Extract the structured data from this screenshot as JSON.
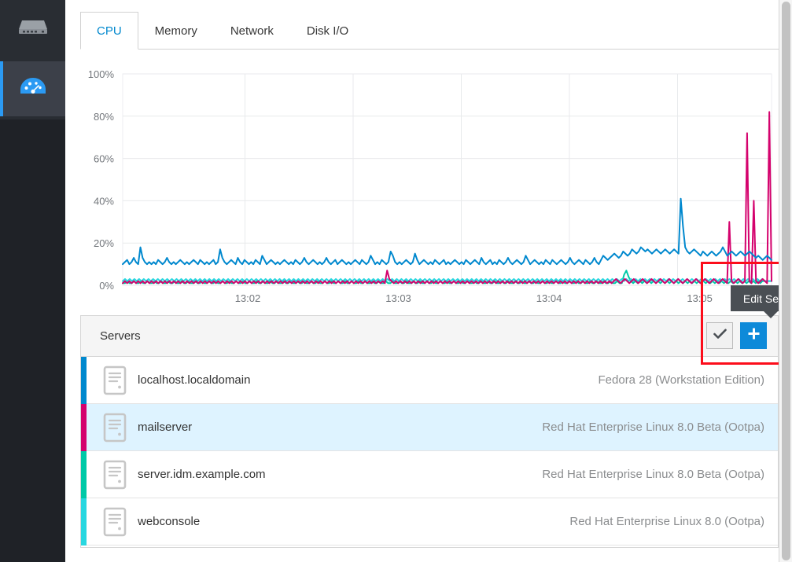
{
  "sidebar": {
    "items": [
      {
        "name": "servers-nav",
        "icon": "server-rack-icon",
        "active": false
      },
      {
        "name": "dashboard-nav",
        "icon": "gauge-dashboard-icon",
        "active": true
      }
    ],
    "accent": "#2b9af3",
    "bg": "#292d33",
    "active_bg": "#3c4049"
  },
  "tabs": [
    {
      "label": "CPU",
      "active": true
    },
    {
      "label": "Memory",
      "active": false
    },
    {
      "label": "Network",
      "active": false
    },
    {
      "label": "Disk I/O",
      "active": false
    }
  ],
  "panel": {
    "title": "Servers",
    "check_button_label": "✔",
    "add_button_label": "+",
    "check_button_name": "edit-server-toggle",
    "add_button_name": "add-server-button"
  },
  "tooltip": {
    "text": "Edit Server"
  },
  "annotation": {
    "color": "#fc0d1b"
  },
  "servers": [
    {
      "name": "localhost.localdomain",
      "os": "Fedora 28 (Workstation Edition)",
      "color": "#0088ce",
      "selected": false
    },
    {
      "name": "mailserver",
      "os": "Red Hat Enterprise Linux 8.0 Beta (Ootpa)",
      "color": "#d4026d",
      "selected": true
    },
    {
      "name": "server.idm.example.com",
      "os": "Red Hat Enterprise Linux 8.0 Beta (Ootpa)",
      "color": "#00c9a7",
      "selected": false
    },
    {
      "name": "webconsole",
      "os": "Red Hat Enterprise Linux 8.0 (Ootpa)",
      "color": "#28d7e0",
      "selected": false
    }
  ],
  "chart_data": {
    "type": "line",
    "title": "",
    "xlabel": "",
    "ylabel": "",
    "ylim": [
      0,
      100
    ],
    "ytick_labels": [
      "0%",
      "20%",
      "40%",
      "60%",
      "80%",
      "100%"
    ],
    "yticks": [
      0,
      20,
      40,
      60,
      80,
      100
    ],
    "xtick_labels": [
      "13:02",
      "13:03",
      "13:04",
      "13:05"
    ],
    "xticks": [
      0.205,
      0.452,
      0.699,
      0.946
    ],
    "grid": true,
    "legend": "none",
    "series": [
      {
        "name": "localhost.localdomain",
        "color": "#0088ce",
        "values": [
          10,
          11,
          12,
          10,
          11,
          13,
          11,
          10,
          18,
          13,
          11,
          10,
          11,
          10,
          11,
          10,
          12,
          11,
          10,
          11,
          13,
          11,
          10,
          11,
          10,
          11,
          12,
          11,
          10,
          11,
          10,
          11,
          12,
          11,
          10,
          12,
          11,
          10,
          11,
          10,
          11,
          12,
          10,
          11,
          17,
          13,
          11,
          10,
          11,
          12,
          11,
          10,
          13,
          11,
          10,
          12,
          11,
          10,
          11,
          10,
          12,
          11,
          10,
          14,
          12,
          10,
          11,
          12,
          11,
          10,
          11,
          10,
          11,
          12,
          11,
          10,
          11,
          10,
          12,
          11,
          10,
          11,
          13,
          11,
          10,
          11,
          12,
          11,
          10,
          11,
          10,
          11,
          13,
          11,
          10,
          11,
          12,
          10,
          11,
          12,
          11,
          10,
          11,
          10,
          11,
          12,
          11,
          10,
          12,
          11,
          10,
          11,
          14,
          12,
          10,
          11,
          10,
          12,
          11,
          10,
          11,
          16,
          14,
          11,
          10,
          11,
          10,
          11,
          12,
          11,
          10,
          11,
          15,
          12,
          10,
          11,
          12,
          11,
          10,
          11,
          10,
          12,
          11,
          10,
          11,
          12,
          10,
          11,
          10,
          11,
          12,
          11,
          10,
          11,
          10,
          12,
          11,
          10,
          11,
          12,
          11,
          10,
          13,
          11,
          10,
          11,
          12,
          10,
          11,
          10,
          12,
          11,
          10,
          11,
          13,
          11,
          10,
          11,
          12,
          11,
          10,
          11,
          14,
          12,
          10,
          11,
          12,
          11,
          10,
          11,
          10,
          12,
          11,
          10,
          12,
          11,
          10,
          11,
          12,
          11,
          10,
          11,
          13,
          11,
          10,
          11,
          12,
          11,
          10,
          12,
          11,
          10,
          11,
          13,
          11,
          10,
          12,
          14,
          13,
          12,
          13,
          14,
          15,
          14,
          13,
          14,
          16,
          15,
          14,
          15,
          17,
          16,
          15,
          16,
          18,
          17,
          16,
          17,
          16,
          15,
          16,
          17,
          16,
          15,
          16,
          17,
          16,
          15,
          16,
          17,
          16,
          15,
          41,
          28,
          18,
          16,
          15,
          16,
          17,
          16,
          15,
          14,
          16,
          15,
          14,
          15,
          16,
          15,
          14,
          15,
          16,
          18,
          16,
          14,
          15,
          16,
          15,
          14,
          15,
          16,
          15,
          14,
          15,
          16,
          15,
          14,
          13,
          14,
          13,
          12,
          13,
          14,
          13,
          12
        ]
      },
      {
        "name": "mailserver",
        "color": "#d4026d",
        "values": [
          1,
          2,
          1,
          2,
          1,
          2,
          1,
          2,
          1,
          2,
          1,
          2,
          1,
          2,
          1,
          2,
          1,
          2,
          1,
          2,
          1,
          2,
          1,
          2,
          1,
          2,
          1,
          2,
          1,
          2,
          1,
          2,
          1,
          2,
          1,
          2,
          1,
          2,
          1,
          2,
          1,
          2,
          1,
          2,
          1,
          2,
          1,
          2,
          1,
          2,
          1,
          2,
          1,
          2,
          1,
          2,
          1,
          2,
          1,
          2,
          1,
          2,
          1,
          2,
          1,
          2,
          1,
          2,
          1,
          2,
          1,
          2,
          1,
          2,
          1,
          2,
          1,
          2,
          1,
          2,
          1,
          2,
          1,
          2,
          1,
          2,
          1,
          2,
          1,
          2,
          1,
          2,
          1,
          2,
          1,
          2,
          1,
          2,
          1,
          2,
          1,
          2,
          1,
          2,
          1,
          2,
          1,
          2,
          1,
          2,
          1,
          2,
          1,
          2,
          1,
          2,
          1,
          2,
          1,
          7,
          3,
          2,
          1,
          2,
          1,
          2,
          1,
          2,
          1,
          2,
          1,
          2,
          1,
          2,
          1,
          2,
          1,
          2,
          1,
          2,
          1,
          2,
          1,
          2,
          1,
          2,
          1,
          2,
          1,
          2,
          1,
          2,
          1,
          2,
          1,
          2,
          1,
          2,
          1,
          2,
          1,
          2,
          1,
          2,
          1,
          2,
          1,
          2,
          1,
          2,
          1,
          2,
          1,
          2,
          1,
          2,
          1,
          2,
          1,
          2,
          1,
          2,
          1,
          2,
          1,
          2,
          1,
          2,
          1,
          2,
          1,
          2,
          1,
          2,
          1,
          2,
          1,
          2,
          1,
          2,
          1,
          2,
          1,
          2,
          1,
          2,
          1,
          2,
          1,
          2,
          1,
          2,
          1,
          2,
          1,
          2,
          1,
          2,
          1,
          2,
          1,
          2,
          3,
          2,
          1,
          2,
          3,
          2,
          1,
          2,
          3,
          2,
          1,
          2,
          3,
          2,
          1,
          2,
          3,
          2,
          1,
          2,
          3,
          2,
          1,
          2,
          3,
          2,
          1,
          2,
          3,
          2,
          1,
          2,
          3,
          2,
          1,
          2,
          3,
          2,
          1,
          2,
          3,
          2,
          1,
          2,
          3,
          2,
          1,
          2,
          3,
          2,
          1,
          30,
          2,
          1,
          2,
          3,
          2,
          1,
          2,
          72,
          2,
          1,
          40,
          2,
          1,
          2,
          3,
          2,
          1,
          82,
          2
        ]
      },
      {
        "name": "server.idm.example.com",
        "color": "#00c9a7",
        "values": [
          1,
          1,
          2,
          1,
          1,
          2,
          1,
          1,
          2,
          1,
          1,
          2,
          1,
          1,
          2,
          1,
          1,
          2,
          1,
          1,
          2,
          1,
          1,
          2,
          1,
          1,
          2,
          1,
          1,
          2,
          1,
          1,
          2,
          1,
          1,
          2,
          1,
          1,
          2,
          1,
          1,
          2,
          1,
          1,
          2,
          1,
          1,
          2,
          1,
          1,
          2,
          1,
          1,
          2,
          1,
          1,
          2,
          1,
          1,
          2,
          1,
          1,
          2,
          1,
          1,
          2,
          1,
          1,
          2,
          1,
          1,
          2,
          1,
          1,
          2,
          1,
          1,
          2,
          1,
          1,
          2,
          1,
          1,
          2,
          1,
          1,
          2,
          1,
          1,
          2,
          1,
          1,
          2,
          1,
          1,
          2,
          1,
          1,
          2,
          1,
          1,
          2,
          1,
          1,
          2,
          1,
          1,
          2,
          1,
          1,
          2,
          1,
          1,
          2,
          1,
          1,
          2,
          1,
          1,
          2,
          1,
          1,
          2,
          1,
          1,
          2,
          1,
          1,
          2,
          1,
          1,
          2,
          1,
          1,
          2,
          1,
          1,
          2,
          1,
          1,
          2,
          1,
          1,
          2,
          1,
          1,
          2,
          1,
          1,
          2,
          1,
          1,
          2,
          1,
          1,
          2,
          1,
          1,
          2,
          1,
          1,
          2,
          1,
          1,
          2,
          1,
          1,
          2,
          1,
          1,
          2,
          1,
          1,
          2,
          1,
          1,
          2,
          1,
          1,
          2,
          1,
          1,
          2,
          1,
          1,
          2,
          1,
          1,
          2,
          1,
          1,
          2,
          1,
          1,
          2,
          1,
          1,
          2,
          1,
          1,
          2,
          1,
          1,
          2,
          1,
          1,
          2,
          1,
          1,
          2,
          1,
          1,
          2,
          1,
          1,
          2,
          1,
          1,
          2,
          1,
          1,
          5,
          7,
          4,
          2,
          1,
          2,
          1,
          2,
          1,
          2,
          1,
          2,
          1,
          2,
          1,
          2,
          1,
          2,
          1,
          2,
          1,
          2,
          1,
          2,
          1,
          2,
          1,
          2,
          1,
          2,
          1,
          2,
          1,
          2,
          1,
          2,
          1,
          2,
          1,
          2,
          1,
          2,
          1,
          2,
          1,
          2,
          1,
          2,
          1,
          2,
          1,
          2,
          1,
          2,
          1,
          2,
          1,
          2,
          1,
          2,
          1,
          2,
          2,
          2,
          2,
          2
        ]
      },
      {
        "name": "webconsole",
        "color": "#28d7e0",
        "values": [
          2,
          3,
          2,
          3,
          2,
          3,
          2,
          3,
          2,
          3,
          2,
          3,
          2,
          3,
          2,
          3,
          2,
          3,
          2,
          3,
          2,
          3,
          2,
          3,
          2,
          3,
          2,
          3,
          2,
          3,
          2,
          3,
          2,
          3,
          2,
          3,
          2,
          3,
          2,
          3,
          2,
          3,
          2,
          3,
          2,
          3,
          2,
          3,
          2,
          3,
          2,
          3,
          2,
          3,
          2,
          3,
          2,
          3,
          2,
          3,
          2,
          3,
          2,
          3,
          2,
          3,
          2,
          3,
          2,
          3,
          2,
          3,
          2,
          3,
          2,
          3,
          2,
          3,
          2,
          3,
          2,
          3,
          2,
          3,
          2,
          3,
          2,
          3,
          2,
          3,
          2,
          3,
          2,
          3,
          2,
          3,
          2,
          3,
          2,
          3,
          2,
          3,
          2,
          3,
          2,
          3,
          2,
          3,
          2,
          3,
          2,
          3,
          2,
          3,
          2,
          3,
          2,
          3,
          2,
          3,
          2,
          3,
          2,
          3,
          2,
          3,
          2,
          3,
          2,
          3,
          2,
          3,
          2,
          3,
          2,
          3,
          2,
          3,
          2,
          3,
          2,
          3,
          2,
          3,
          2,
          3,
          2,
          3,
          2,
          3,
          2,
          3,
          2,
          3,
          2,
          3,
          2,
          3,
          2,
          3,
          2,
          3,
          2,
          3,
          2,
          3,
          2,
          3,
          2,
          3,
          2,
          3,
          2,
          3,
          2,
          3,
          2,
          3,
          2,
          3,
          2,
          3,
          2,
          3,
          2,
          3,
          2,
          3,
          2,
          3,
          2,
          3,
          2,
          3,
          2,
          3,
          2,
          3,
          2,
          3,
          2,
          3,
          2,
          3,
          2,
          3,
          2,
          3,
          2,
          3,
          2,
          3,
          2,
          3,
          2,
          3,
          2,
          3,
          2,
          3,
          2,
          3,
          2,
          3,
          2,
          3,
          2,
          3,
          2,
          3,
          2,
          3,
          2,
          3,
          2,
          3,
          2,
          3,
          2,
          3,
          2,
          3,
          2,
          3,
          2,
          3,
          2,
          3,
          2,
          3,
          2,
          3,
          2,
          3,
          2,
          3,
          2,
          3,
          2,
          3,
          2,
          3,
          2,
          3,
          2,
          3,
          2,
          3,
          2,
          3,
          2,
          3,
          2,
          3,
          2,
          2,
          2,
          2
        ]
      }
    ]
  }
}
